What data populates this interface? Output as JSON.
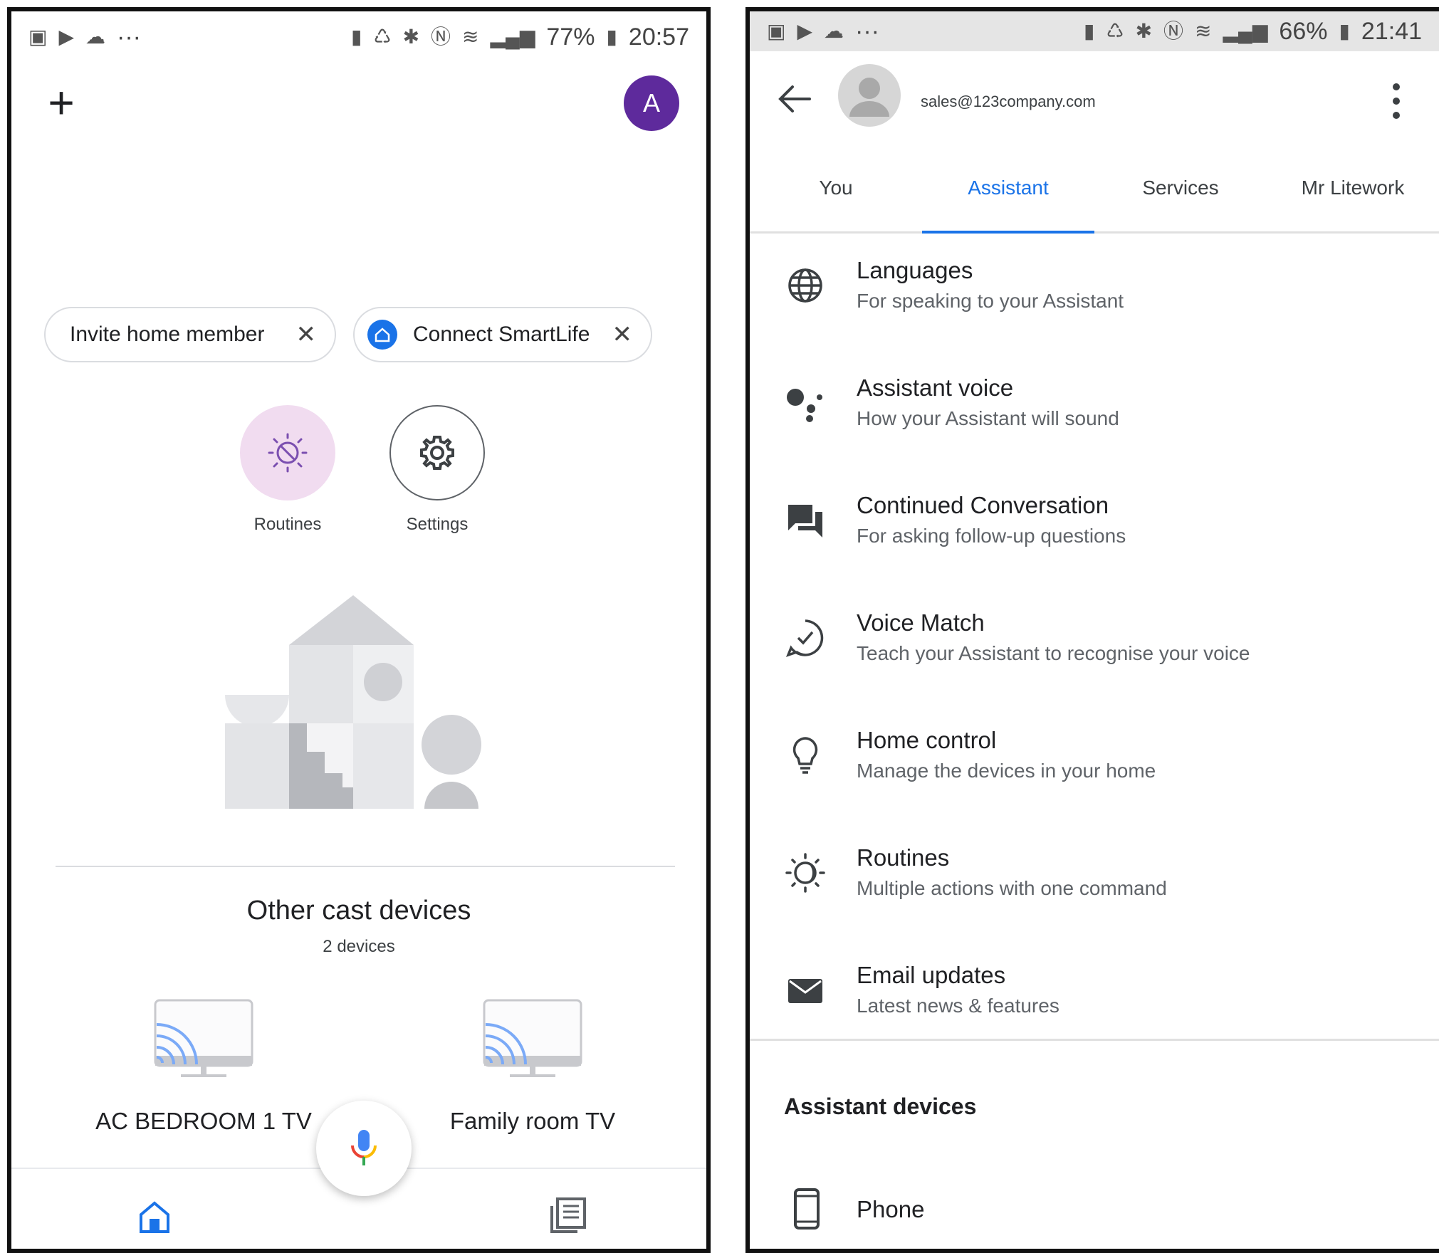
{
  "left_screen": {
    "status": {
      "battery_percent": "77%",
      "time": "20:57",
      "overflow": "···"
    },
    "avatar_letter": "A",
    "chips": {
      "invite": "Invite home member",
      "smartlife": "Connect SmartLife"
    },
    "actions": {
      "routines": "Routines",
      "settings": "Settings"
    },
    "section": {
      "title": "Other cast devices",
      "count": "2 devices"
    },
    "devices": [
      {
        "label": "AC BEDROOM 1 TV"
      },
      {
        "label": "Family room TV"
      }
    ]
  },
  "right_screen": {
    "status": {
      "battery_percent": "66%",
      "time": "21:41",
      "overflow": "···"
    },
    "account_email": "sales@123company.com",
    "tabs": [
      {
        "label": "You",
        "active": false
      },
      {
        "label": "Assistant",
        "active": true
      },
      {
        "label": "Services",
        "active": false
      },
      {
        "label": "Mr Litework",
        "active": false
      }
    ],
    "settings": [
      {
        "title": "Languages",
        "subtitle": "For speaking to your Assistant",
        "icon": "globe-icon"
      },
      {
        "title": "Assistant voice",
        "subtitle": "How your Assistant will sound",
        "icon": "assistant-dots-icon"
      },
      {
        "title": "Continued Conversation",
        "subtitle": "For asking follow-up questions",
        "icon": "chat-icon"
      },
      {
        "title": "Voice Match",
        "subtitle": "Teach your Assistant to recognise your voice",
        "icon": "voice-match-icon"
      },
      {
        "title": "Home control",
        "subtitle": "Manage the devices in your home",
        "icon": "lightbulb-icon"
      },
      {
        "title": "Routines",
        "subtitle": "Multiple actions with one command",
        "icon": "routines-icon"
      },
      {
        "title": "Email updates",
        "subtitle": "Latest news & features",
        "icon": "email-icon"
      }
    ],
    "devices_header": "Assistant devices",
    "phone_label": "Phone"
  },
  "colors": {
    "accent_blue": "#1a73e8",
    "avatar_purple": "#5e2a9c",
    "routines_bg": "#f1dcf0",
    "statusbar_right_bg": "#e5e5e5"
  }
}
